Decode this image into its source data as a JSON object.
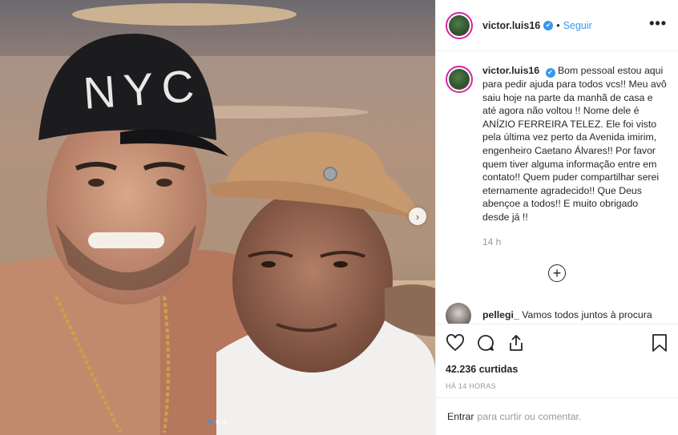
{
  "post": {
    "username": "victor.luis16",
    "verified_mark": "✔",
    "separator": "•",
    "follow_label": "Seguir",
    "more_label": "•••",
    "caption": "Bom pessoal estou aqui para pedir ajuda para todos vcs!! Meu avô saiu hoje na parte da manhã de casa e até agora não voltou !! Nome dele é ANÍZIO FERREIRA TELEZ. Ele foi visto pela última vez perto da Avenida imirim, engenheiro Caetano Álvares!! Por favor quem tiver alguma informação entre em contato!! Quem puder compartilhar serei eternamente agradecido!! Que Deus abençoe a todos!! E muito obrigado desde já !!",
    "caption_time": "14 h",
    "load_more_label": "+",
    "photo_cap_text": "NYC",
    "next_arrow_label": "›"
  },
  "comments": [
    {
      "username": "pellegi_",
      "text": "Vamos todos juntos à procura"
    }
  ],
  "actions": {
    "likes": "42.236 curtidas",
    "posted": "HÁ 14 HORAS"
  },
  "add_comment": {
    "login_label": "Entrar",
    "rest_label": "para curtir ou comentar."
  },
  "carousel": {
    "count": 3,
    "active": 1
  },
  "colors": {
    "accent": "#3897f0",
    "text": "#262626",
    "muted": "#999999",
    "border": "#efefef"
  }
}
